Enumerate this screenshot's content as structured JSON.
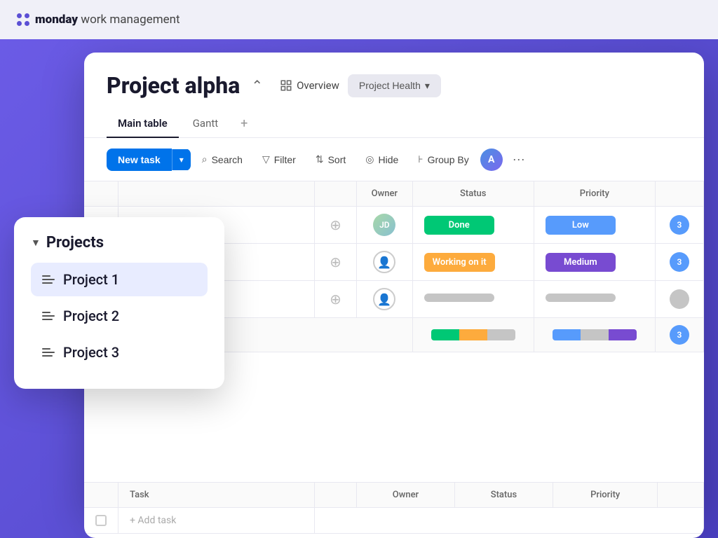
{
  "app": {
    "brand": "monday",
    "brand_suffix": " work management",
    "logo_color": "#5b4fd4"
  },
  "project": {
    "title": "Project alpha",
    "overview_label": "Overview",
    "health_label": "Project Health"
  },
  "tabs": [
    {
      "label": "Main table",
      "active": true
    },
    {
      "label": "Gantt",
      "active": false
    }
  ],
  "toolbar": {
    "new_task_label": "New task",
    "search_label": "Search",
    "filter_label": "Filter",
    "sort_label": "Sort",
    "hide_label": "Hide",
    "group_by_label": "Group By",
    "more_label": "···"
  },
  "table": {
    "columns": {
      "owner": "Owner",
      "status": "Status",
      "priority": "Priority"
    },
    "rows": [
      {
        "has_avatar": true,
        "status": "Done",
        "status_class": "status-done",
        "priority": "Low",
        "priority_class": "priority-low",
        "number": "3"
      },
      {
        "has_avatar": false,
        "status": "Working on it",
        "status_class": "status-working",
        "priority": "Medium",
        "priority_class": "priority-medium",
        "number": "3"
      },
      {
        "has_avatar": false,
        "status": "",
        "status_class": "status-empty",
        "priority": "",
        "priority_class": "priority-empty",
        "number": ""
      }
    ]
  },
  "sidebar": {
    "title": "Projects",
    "items": [
      {
        "label": "Project 1",
        "active": true
      },
      {
        "label": "Project 2",
        "active": false
      },
      {
        "label": "Project 3",
        "active": false
      }
    ]
  },
  "bottom_table": {
    "task_col": "Task",
    "owner_col": "Owner",
    "status_col": "Status",
    "priority_col": "Priority",
    "add_task_label": "+ Add task"
  }
}
